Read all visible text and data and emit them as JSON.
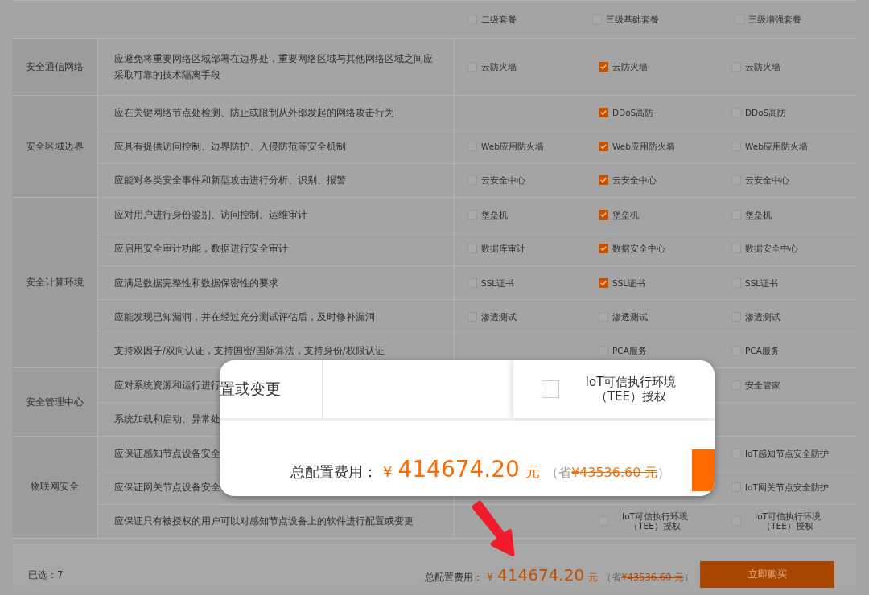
{
  "packages": [
    {
      "label": "二级套餐",
      "checked": false
    },
    {
      "label": "三级基础套餐",
      "checked": false
    },
    {
      "label": "三级增强套餐",
      "checked": false
    }
  ],
  "groups": [
    {
      "category": "安全通信网络",
      "rows": [
        {
          "requirement": "应避免将重要网络区域部署在边界处，重要网络区域与其他网络区域之间应采取可靠的技术隔离手段",
          "options": {
            "level2": {
              "label": "云防火墙",
              "checked": false
            },
            "level3_basic": {
              "label": "云防火墙",
              "checked": true
            },
            "level3_enhanced": {
              "label": "云防火墙",
              "checked": false
            }
          }
        }
      ]
    },
    {
      "category": "安全区域边界",
      "rows": [
        {
          "requirement": "应在关键网络节点处检测、防止或限制从外部发起的网络攻击行为",
          "options": {
            "level3_basic": {
              "label": "DDoS高防",
              "checked": true
            },
            "level3_enhanced": {
              "label": "DDoS高防",
              "checked": false
            }
          }
        },
        {
          "requirement": "应具有提供访问控制、边界防护、入侵防范等安全机制",
          "options": {
            "level2": {
              "label": "Web应用防火墙",
              "checked": false
            },
            "level3_basic": {
              "label": "Web应用防火墙",
              "checked": true
            },
            "level3_enhanced": {
              "label": "Web应用防火墙",
              "checked": false
            }
          }
        },
        {
          "requirement": "应能对各类安全事件和新型攻击进行分析、识别、报警",
          "options": {
            "level2": {
              "label": "云安全中心",
              "checked": false
            },
            "level3_basic": {
              "label": "云安全中心",
              "checked": true
            },
            "level3_enhanced": {
              "label": "云安全中心",
              "checked": false
            }
          }
        }
      ]
    },
    {
      "category": "安全计算环境",
      "rows": [
        {
          "requirement": "应对用户进行身份鉴别、访问控制、运维审计",
          "options": {
            "level2": {
              "label": "堡垒机",
              "checked": false
            },
            "level3_basic": {
              "label": "堡垒机",
              "checked": true
            },
            "level3_enhanced": {
              "label": "堡垒机",
              "checked": false
            }
          }
        },
        {
          "requirement": "应启用安全审计功能，数据进行安全审计",
          "options": {
            "level2": {
              "label": "数据库审计",
              "checked": false
            },
            "level3_basic": {
              "label": "数据安全中心",
              "checked": true
            },
            "level3_enhanced": {
              "label": "数据安全中心",
              "checked": false
            }
          }
        },
        {
          "requirement": "应满足数据完整性和数据保密性的要求",
          "options": {
            "level2": {
              "label": "SSL证书",
              "checked": false
            },
            "level3_basic": {
              "label": "SSL证书",
              "checked": true
            },
            "level3_enhanced": {
              "label": "SSL证书",
              "checked": false
            }
          }
        },
        {
          "requirement": "应能发现已知漏洞，并在经过充分测试评估后，及时修补漏洞",
          "options": {
            "level2": {
              "label": "渗透测试",
              "checked": false
            },
            "level3_basic": {
              "label": "渗透测试",
              "checked": false
            },
            "level3_enhanced": {
              "label": "渗透测试",
              "checked": false
            }
          }
        },
        {
          "requirement": "支持双因子/双向认证，支持国密/国际算法，支持身份/权限认证",
          "options": {
            "level3_basic": {
              "label": "PCA服务",
              "checked": false
            },
            "level3_enhanced": {
              "label": "PCA服务",
              "checked": false
            }
          }
        }
      ]
    },
    {
      "category": "安全管理中心",
      "rows": [
        {
          "requirement": "应对系统资源和运行进行",
          "options": {
            "level3_enhanced": {
              "label": "安全管家",
              "checked": false
            }
          }
        },
        {
          "requirement": "系统加载和启动、异常处",
          "options": {}
        }
      ]
    },
    {
      "category": "物联网安全",
      "rows": [
        {
          "requirement": "应保证感知节点设备安全",
          "options": {
            "level3_enhanced": {
              "label": "IoT感知节点安全防护",
              "checked": false
            }
          }
        },
        {
          "requirement": "应保证网关节点设备安全",
          "options": {
            "level3_enhanced": {
              "label": "IoT网关节点安全防护",
              "checked": false
            }
          }
        },
        {
          "requirement": "应保证只有被授权的用户可以对感知节点设备上的软件进行配置或变更",
          "options": {
            "level3_basic": {
              "label": "IoT可信执行环境（TEE）授权",
              "checked": false
            },
            "level3_enhanced": {
              "label": "IoT可信执行环境（TEE）授权",
              "checked": false
            }
          }
        }
      ]
    }
  ],
  "footer": {
    "selected": "已选：7",
    "total_label": "总配置费用：",
    "currency": "¥",
    "total": "414674.20",
    "unit": "元",
    "saving_prefix": "（省",
    "saving": "¥43536.60 元",
    "saving_suffix": "）",
    "buy_button": "立即购买"
  },
  "callout": {
    "fragment": "置或变更",
    "option": {
      "label": "IoT可信执行环境（TEE）授权",
      "checked": false
    },
    "total_label": "总配置费用：",
    "currency": "¥",
    "total": "414674.20",
    "unit": "元",
    "saving_prefix": "（省",
    "saving": "¥43536.60 元",
    "saving_suffix": "）"
  }
}
